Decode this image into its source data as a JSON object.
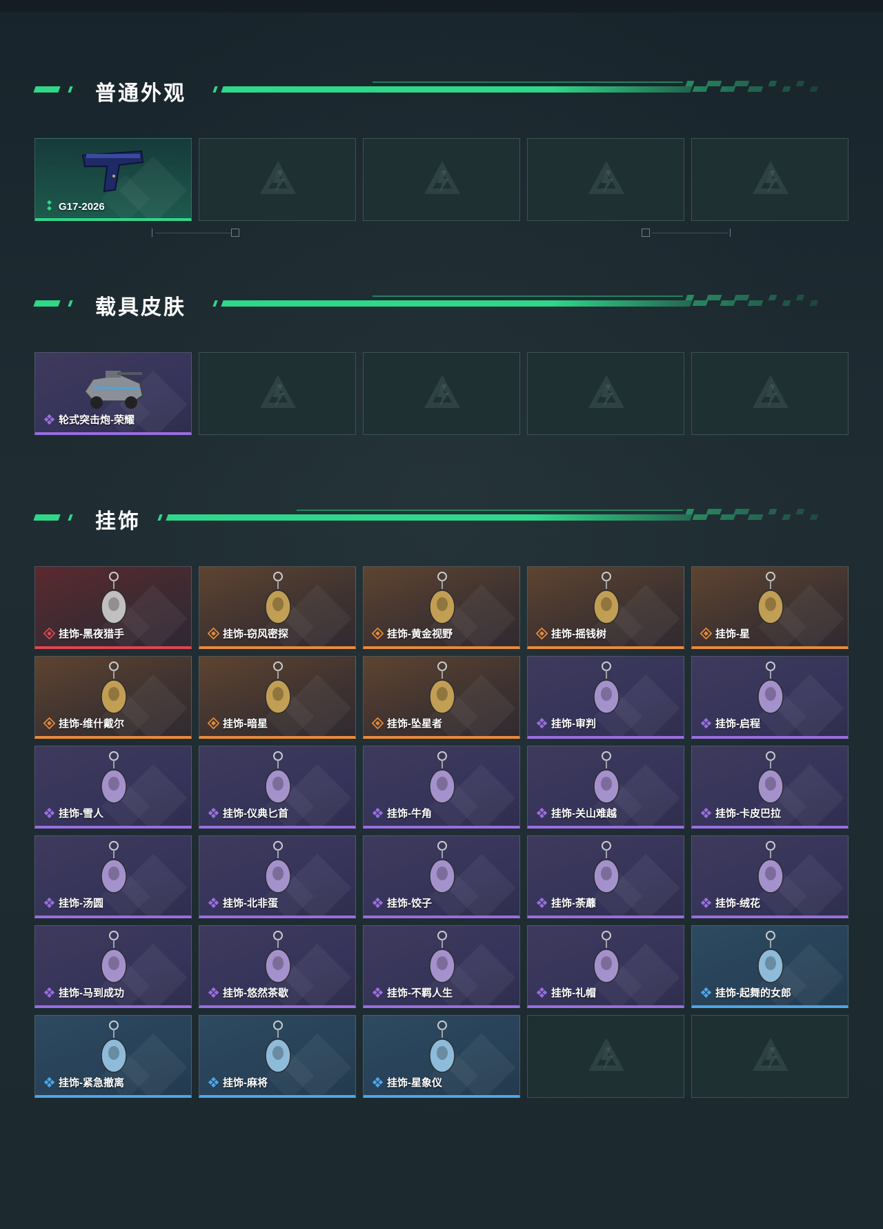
{
  "sections": [
    {
      "title": "普通外观"
    },
    {
      "title": "载具皮肤"
    },
    {
      "title": "挂饰"
    }
  ],
  "weapon_skins": [
    {
      "label": "G17-2026",
      "rarity": "green",
      "icon": "pistol-icon"
    }
  ],
  "vehicle_skins": [
    {
      "label": "轮式突击炮-荣耀",
      "rarity": "purple",
      "icon": "armored-car-icon"
    }
  ],
  "charms": [
    {
      "label": "挂饰-黑夜猎手",
      "rarity": "red",
      "icon": "wolf-charm-icon"
    },
    {
      "label": "挂饰-窃风密探",
      "rarity": "orange",
      "icon": "rabbit-charm-icon"
    },
    {
      "label": "挂饰-黄金视野",
      "rarity": "orange",
      "icon": "fox-charm-icon"
    },
    {
      "label": "挂饰-摇钱树",
      "rarity": "orange",
      "icon": "money-tree-charm-icon"
    },
    {
      "label": "挂饰-星",
      "rarity": "orange",
      "icon": "tarot-card-charm-icon"
    },
    {
      "label": "挂饰-维什戴尔",
      "rarity": "orange",
      "icon": "white-box-charm-icon"
    },
    {
      "label": "挂饰-暗星",
      "rarity": "orange",
      "icon": "feather-blade-charm-icon"
    },
    {
      "label": "挂饰-坠星者",
      "rarity": "orange",
      "icon": "crystal-charm-icon"
    },
    {
      "label": "挂饰-审判",
      "rarity": "purple",
      "icon": "card-charm-icon"
    },
    {
      "label": "挂饰-启程",
      "rarity": "purple",
      "icon": "ring-logo-charm-icon"
    },
    {
      "label": "挂饰-雪人",
      "rarity": "purple",
      "icon": "snowman-charm-icon"
    },
    {
      "label": "挂饰-仪典匕首",
      "rarity": "purple",
      "icon": "dagger-charm-icon"
    },
    {
      "label": "挂饰-牛角",
      "rarity": "purple",
      "icon": "horns-charm-icon"
    },
    {
      "label": "挂饰-关山难越",
      "rarity": "purple",
      "icon": "scroll-charm-icon"
    },
    {
      "label": "挂饰-卡皮巴拉",
      "rarity": "purple",
      "icon": "capybara-charm-icon"
    },
    {
      "label": "挂饰-汤圆",
      "rarity": "purple",
      "icon": "dumpling-bowl-charm-icon"
    },
    {
      "label": "挂饰-北非蛋",
      "rarity": "purple",
      "icon": "egg-dish-charm-icon"
    },
    {
      "label": "挂饰-饺子",
      "rarity": "purple",
      "icon": "dumpling-plate-charm-icon"
    },
    {
      "label": "挂饰-荼蘼",
      "rarity": "purple",
      "icon": "flower-charm-icon"
    },
    {
      "label": "挂饰-绒花",
      "rarity": "purple",
      "icon": "red-flower-charm-icon"
    },
    {
      "label": "挂饰-马到成功",
      "rarity": "purple",
      "icon": "horse-charm-icon"
    },
    {
      "label": "挂饰-悠然茶歇",
      "rarity": "purple",
      "icon": "cupcake-charm-icon"
    },
    {
      "label": "挂饰-不羁人生",
      "rarity": "purple",
      "icon": "sneaker-charm-icon"
    },
    {
      "label": "挂饰-礼帽",
      "rarity": "purple",
      "icon": "hat-charm-icon"
    },
    {
      "label": "挂饰-起舞的女郎",
      "rarity": "blue",
      "icon": "dancer-charm-icon"
    },
    {
      "label": "挂饰-紧急撤离",
      "rarity": "blue",
      "icon": "exit-sign-charm-icon"
    },
    {
      "label": "挂饰-麻将",
      "rarity": "blue",
      "icon": "mahjong-charm-icon"
    },
    {
      "label": "挂饰-星象仪",
      "rarity": "blue",
      "icon": "astrolabe-charm-icon"
    }
  ],
  "colors": {
    "accent": "#2fd889",
    "rarity_green": "#2fd889",
    "rarity_red": "#e0474f",
    "rarity_orange": "#e88b3a",
    "rarity_purple": "#9a6ee0",
    "rarity_blue": "#4da6e8"
  }
}
